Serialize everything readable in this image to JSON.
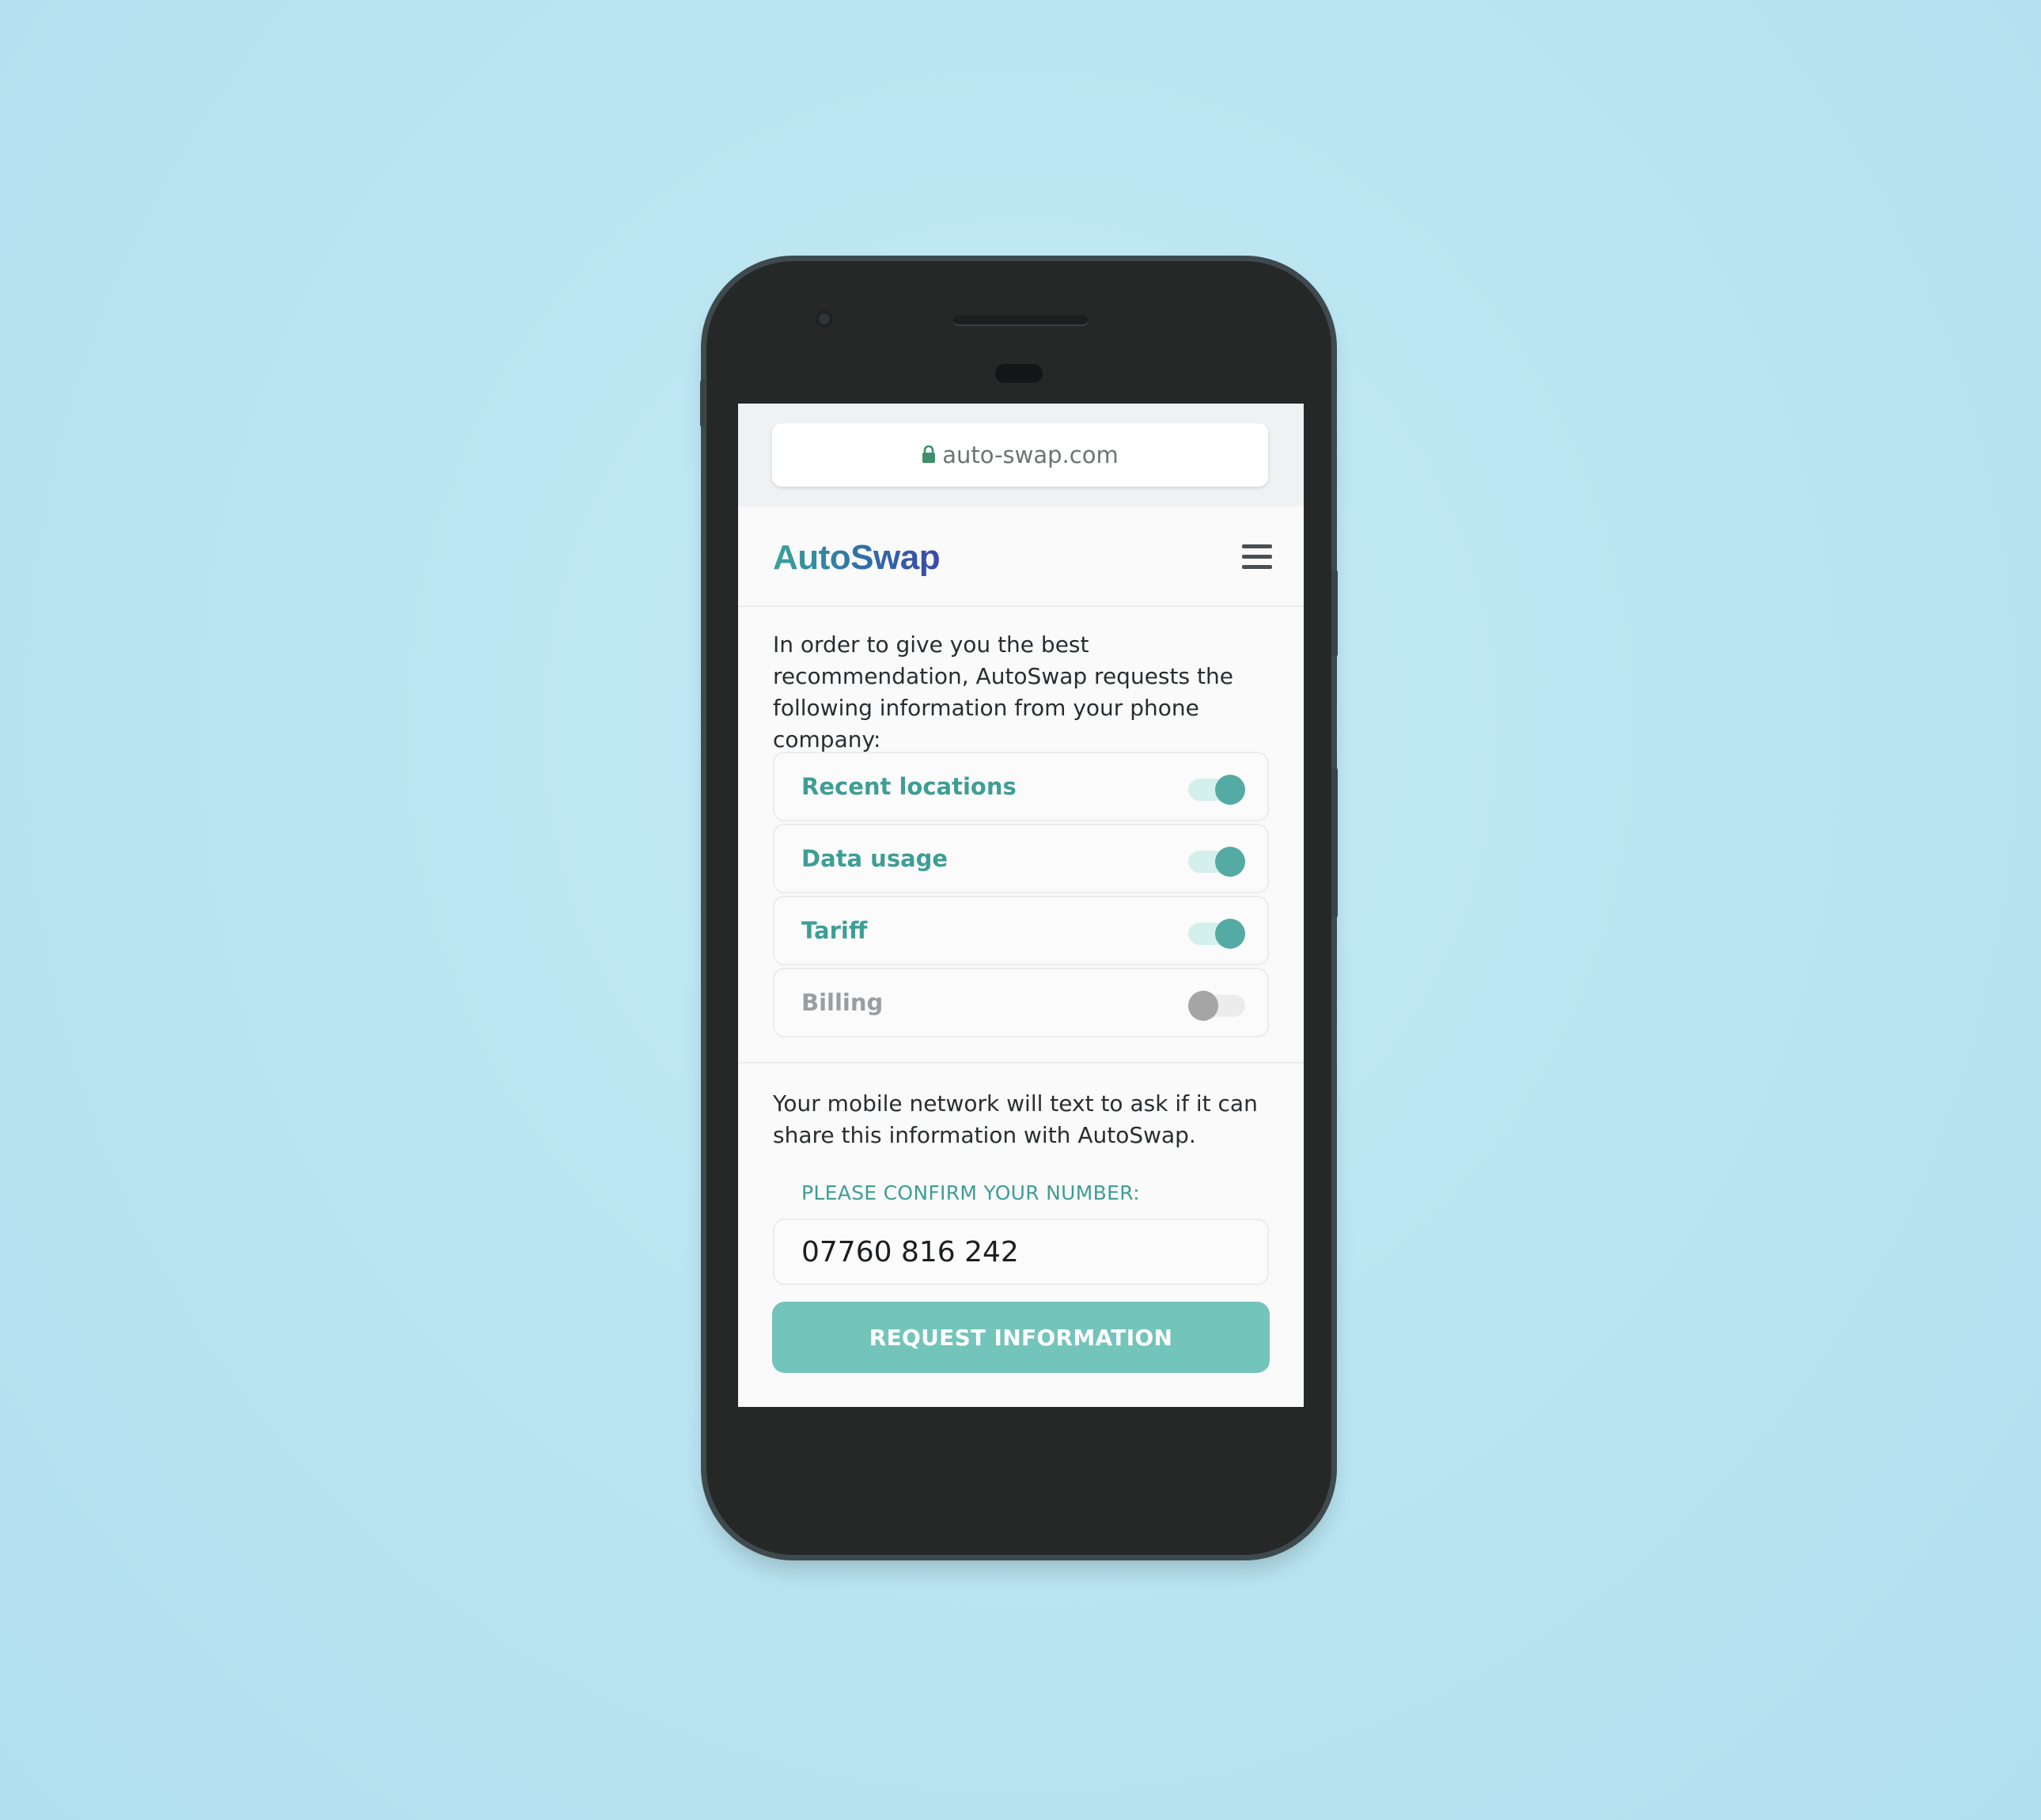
{
  "browser": {
    "url": "auto-swap.com",
    "lock_icon": "lock-icon"
  },
  "header": {
    "logo_text": "AutoSwap",
    "menu_icon": "hamburger-menu-icon"
  },
  "intro_text": "In order to give you the best recommendation, AutoSwap requests the following information from your phone company:",
  "permissions": [
    {
      "label": "Recent locations",
      "enabled": true
    },
    {
      "label": "Data usage",
      "enabled": true
    },
    {
      "label": "Tariff",
      "enabled": true
    },
    {
      "label": "Billing",
      "enabled": false
    }
  ],
  "notice_text": "Your mobile network will text to ask if it can share this information with AutoSwap.",
  "confirm": {
    "label": "PLEASE CONFIRM YOUR NUMBER:",
    "phone_number": "07760 816 242"
  },
  "cta_label": "REQUEST INFORMATION",
  "colors": {
    "accent": "#54aba3",
    "button": "#73c4bb",
    "background": "#bde7f3"
  }
}
